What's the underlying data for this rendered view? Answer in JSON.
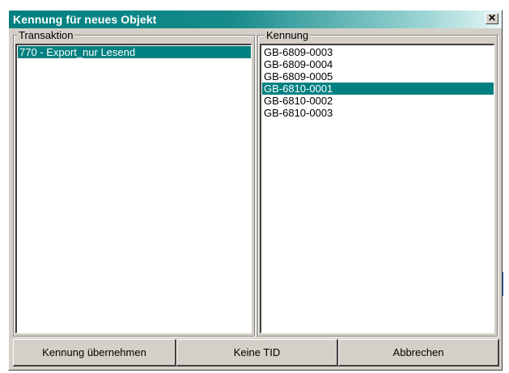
{
  "window": {
    "title": "Kennung für neues Objekt",
    "close_glyph": "✕"
  },
  "transaktion": {
    "legend": "Transaktion",
    "items": [
      {
        "label": "770 - Export_nur Lesend",
        "selected": true
      }
    ]
  },
  "kennung": {
    "legend": "Kennung",
    "items": [
      {
        "label": "GB-6809-0003",
        "selected": false
      },
      {
        "label": "GB-6809-0004",
        "selected": false
      },
      {
        "label": "GB-6809-0005",
        "selected": false
      },
      {
        "label": "GB-6810-0001",
        "selected": true
      },
      {
        "label": "GB-6810-0002",
        "selected": false
      },
      {
        "label": "GB-6810-0003",
        "selected": false
      }
    ]
  },
  "buttons": {
    "accept": "Kennung übernehmen",
    "no_tid": "Keine TID",
    "cancel": "Abbrechen"
  },
  "colors": {
    "title_gradient_start": "#008080",
    "selection": "#008080",
    "face": "#d4d0c8"
  },
  "icons": {
    "close": "close-icon"
  }
}
